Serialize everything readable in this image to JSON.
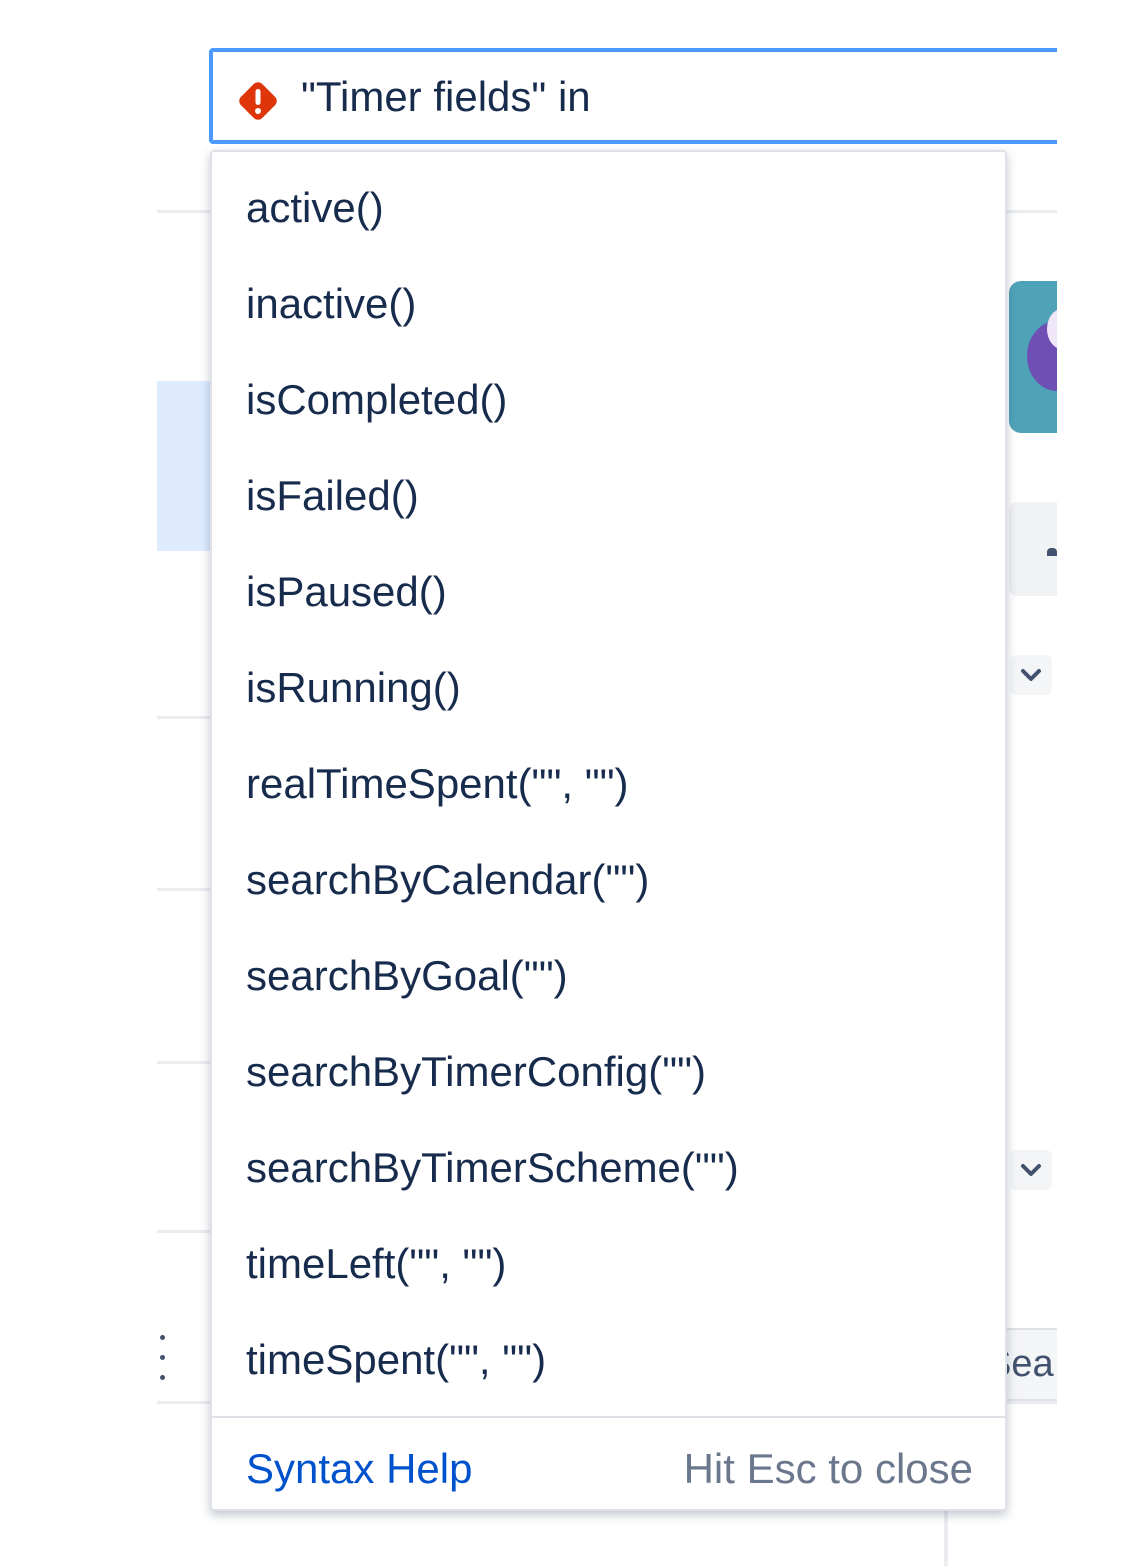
{
  "search": {
    "query": "\"Timer fields\" in",
    "error_icon": "error-diamond-icon",
    "border_color": "#4c9aff",
    "error_color": "#de350b"
  },
  "dropdown": {
    "options": [
      "active()",
      "inactive()",
      "isCompleted()",
      "isFailed()",
      "isPaused()",
      "isRunning()",
      "realTimeSpent(\"\", \"\")",
      "searchByCalendar(\"\")",
      "searchByGoal(\"\")",
      "searchByTimerConfig(\"\")",
      "searchByTimerScheme(\"\")",
      "timeLeft(\"\", \"\")",
      "timeSpent(\"\", \"\")"
    ],
    "footer": {
      "syntax_help": "Syntax Help",
      "esc_hint": "Hit Esc to close"
    }
  },
  "background": {
    "partial_button_label": "Sea",
    "icons": [
      "chevron-down-icon",
      "chevron-down-icon",
      "kebab-menu-icon"
    ]
  }
}
